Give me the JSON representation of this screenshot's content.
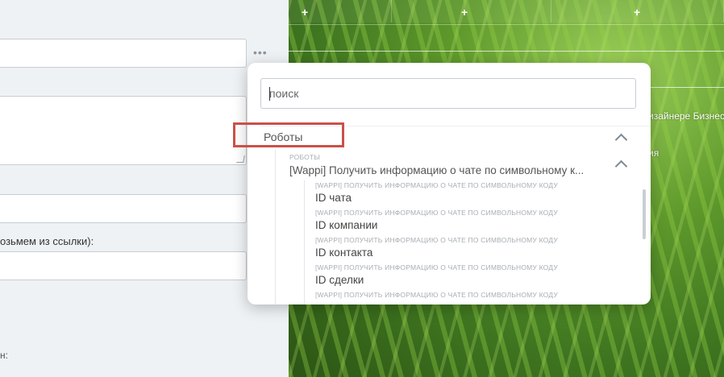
{
  "form": {
    "more_label": "•••",
    "hint_text": "озьмем из ссылки):",
    "bottom_label": "н:"
  },
  "background": {
    "plus_buttons": [
      "+",
      "+",
      "+"
    ],
    "text_line_1": "изайнере Бизнес-",
    "text_line_2": "ия"
  },
  "popup": {
    "search_placeholder": "поиск",
    "group_title": "Роботы",
    "robots_caption": "РОБОТЫ",
    "robot_title": "[Wappi] Получить информацию о чате по символьному к...",
    "fields": [
      {
        "caption": "[WAPPI] ПОЛУЧИТЬ ИНФОРМАЦИЮ О ЧАТЕ ПО СИМВОЛЬНОМУ КОДУ",
        "label": "ID чата"
      },
      {
        "caption": "[WAPPI] ПОЛУЧИТЬ ИНФОРМАЦИЮ О ЧАТЕ ПО СИМВОЛЬНОМУ КОДУ",
        "label": "ID компании"
      },
      {
        "caption": "[WAPPI] ПОЛУЧИТЬ ИНФОРМАЦИЮ О ЧАТЕ ПО СИМВОЛЬНОМУ КОДУ",
        "label": "ID контакта"
      },
      {
        "caption": "[WAPPI] ПОЛУЧИТЬ ИНФОРМАЦИЮ О ЧАТЕ ПО СИМВОЛЬНОМУ КОДУ",
        "label": "ID сделки"
      },
      {
        "caption": "[WAPPI] ПОЛУЧИТЬ ИНФОРМАЦИЮ О ЧАТЕ ПО СИМВОЛЬНОМУ КОДУ",
        "label": ""
      }
    ]
  },
  "colors": {
    "highlight_border": "#c9514a",
    "panel_bg": "#eef2f4"
  }
}
